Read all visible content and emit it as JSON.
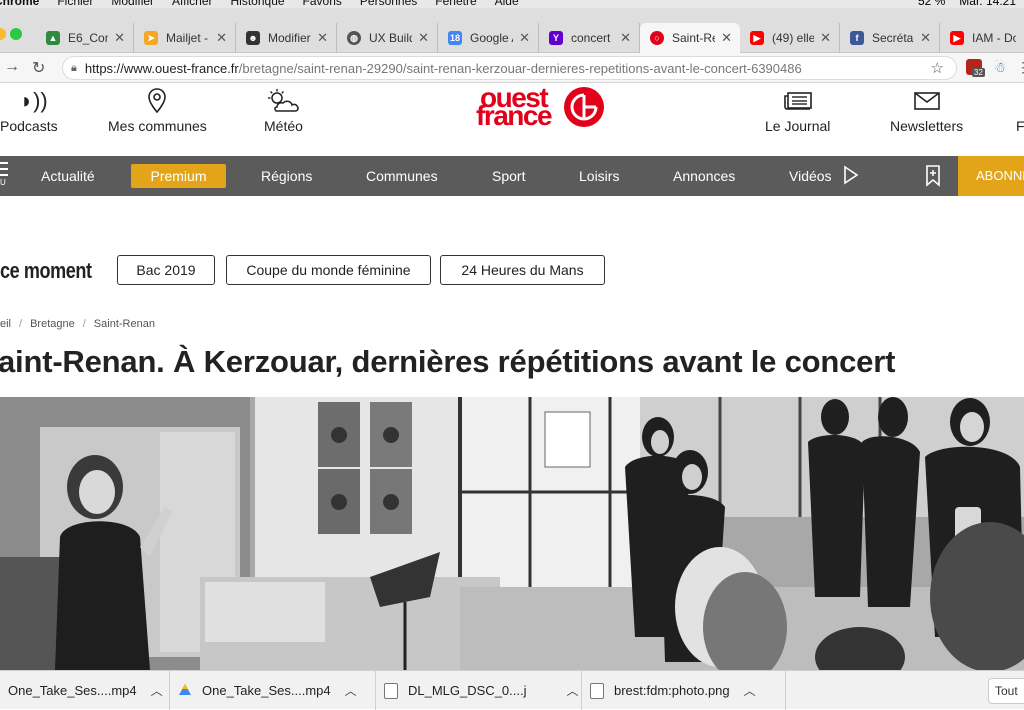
{
  "menubar": {
    "app": "Chrome",
    "items": [
      "Fichier",
      "Modifier",
      "Afficher",
      "Historique",
      "Favoris",
      "Personnes",
      "Fenêtre",
      "Aide"
    ],
    "battery": "52 %",
    "clock": "Mar. 14:21"
  },
  "tabs": [
    {
      "title": "E6_Cons",
      "favicon": "drive-icon",
      "color": "#2f8a3e"
    },
    {
      "title": "Mailjet -",
      "favicon": "mailjet-icon",
      "color": "#f5a623"
    },
    {
      "title": "Modifier",
      "favicon": "person-icon",
      "color": "#333333"
    },
    {
      "title": "UX Build",
      "favicon": "globe-icon",
      "color": "#555555"
    },
    {
      "title": "Google A",
      "favicon": "calendar-icon",
      "color": "#4285f4"
    },
    {
      "title": "concert",
      "favicon": "yahoo-icon",
      "color": "#6001d2"
    },
    {
      "title": "Saint-Re",
      "favicon": "ouest-france-icon",
      "color": "#e2001a",
      "active": true
    },
    {
      "title": "(49) elle",
      "favicon": "youtube-icon",
      "color": "#ff0000"
    },
    {
      "title": "Secrétai",
      "favicon": "facebook-icon",
      "color": "#3b5998"
    },
    {
      "title": "IAM - Do",
      "favicon": "youtube-icon",
      "color": "#ff0000"
    }
  ],
  "address": {
    "host": "https://www.ouest-france.fr",
    "path": "/bretagne/saint-renan-29290/saint-renan-kerzouar-dernieres-repetitions-avant-le-concert-6390486",
    "ext_badge": "32"
  },
  "header": {
    "podcasts": "Podcasts",
    "communes": "Mes communes",
    "meteo": "Météo",
    "logo_top": "ouest",
    "logo_bottom": "france",
    "journal": "Le Journal",
    "newsletters": "Newsletters",
    "extra": "F"
  },
  "nav": {
    "menu": "U",
    "items": [
      "Actualité",
      "Premium",
      "Régions",
      "Communes",
      "Sport",
      "Loisirs",
      "Annonces",
      "Vidéos"
    ],
    "subscribe": "ABONNE"
  },
  "content": {
    "moment_label": "ce moment",
    "chips": [
      "Bac 2019",
      "Coupe du monde féminine",
      "24 Heures du Mans"
    ],
    "breadcrumb": [
      "eil",
      "Bretagne",
      "Saint-Renan"
    ],
    "headline": "aint-Renan. À Kerzouar, dernières répétitions avant le concert"
  },
  "downloads": [
    {
      "name": "One_Take_Ses....mp4",
      "icon": "video-file-icon"
    },
    {
      "name": "One_Take_Ses....mp4",
      "icon": "drive-file-icon"
    },
    {
      "name": "DL_MLG_DSC_0....j",
      "icon": "image-file-icon"
    },
    {
      "name": "brest:fdm:photo.png",
      "icon": "image-file-icon"
    }
  ],
  "show_all": "Tout"
}
